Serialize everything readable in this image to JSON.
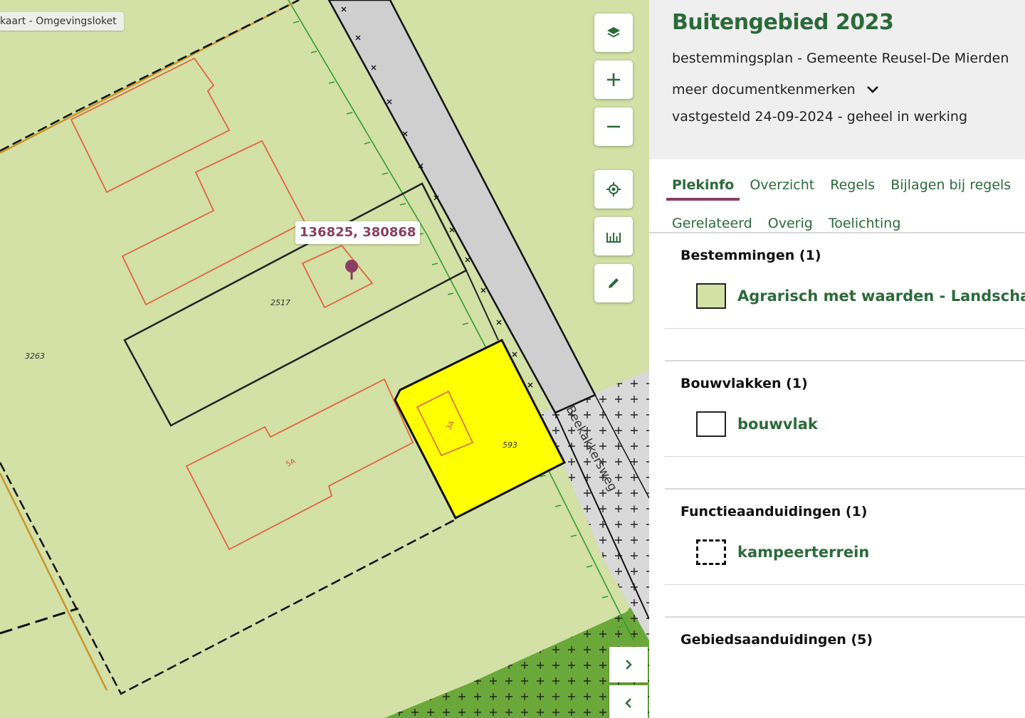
{
  "map": {
    "attribution": "kaart - Omgevingsloket",
    "coordinate": "136825, 380868",
    "parcel_numbers": [
      "2517",
      "3263",
      "593"
    ],
    "building_numbers": [
      "5A",
      "3A"
    ],
    "street_name": "Beekakkersweg",
    "colors": {
      "background": "#d3e0a6",
      "road": "#cfcfcf",
      "highlight": "#ffff00",
      "green_area": "#6ba83a",
      "building_outline": "#e0663c",
      "dyke_line": "#2e9e2e",
      "pin": "#8a3e64"
    },
    "controls": {
      "layers_icon": "layers-icon",
      "zoom_in_icon": "plus-icon",
      "zoom_out_icon": "minus-icon",
      "locate_icon": "crosshair-icon",
      "measure_icon": "ruler-icon",
      "draw_icon": "pencil-icon",
      "expand_icon": "chevron-right-icon",
      "collapse_icon": "chevron-left-icon"
    }
  },
  "panel": {
    "title": "Buitengebied 2023",
    "subtitle": "bestemmingsplan - Gemeente Reusel-De Mierden",
    "more_label": "meer documentkenmerken",
    "status": "vastgesteld 24-09-2024 - geheel in werking",
    "tabs_row1": [
      "Plekinfo",
      "Overzicht",
      "Regels",
      "Bijlagen bij regels"
    ],
    "tabs_row2": [
      "Gerelateerd",
      "Overig",
      "Toelichting"
    ],
    "active_tab": "Plekinfo",
    "sections": [
      {
        "title": "Bestemmingen (1)",
        "item": "Agrarisch met waarden - Landschap",
        "swatch": "filled"
      },
      {
        "title": "Bouwvlakken (1)",
        "item": "bouwvlak",
        "swatch": "outline"
      },
      {
        "title": "Functieaanduidingen (1)",
        "item": "kampeerterrein",
        "swatch": "dashed"
      },
      {
        "title": "Gebiedsaanduidingen (5)",
        "item": "",
        "swatch": "none"
      }
    ],
    "colors": {
      "accent": "#2b6a3a",
      "tab_underline": "#8a3e64"
    }
  }
}
